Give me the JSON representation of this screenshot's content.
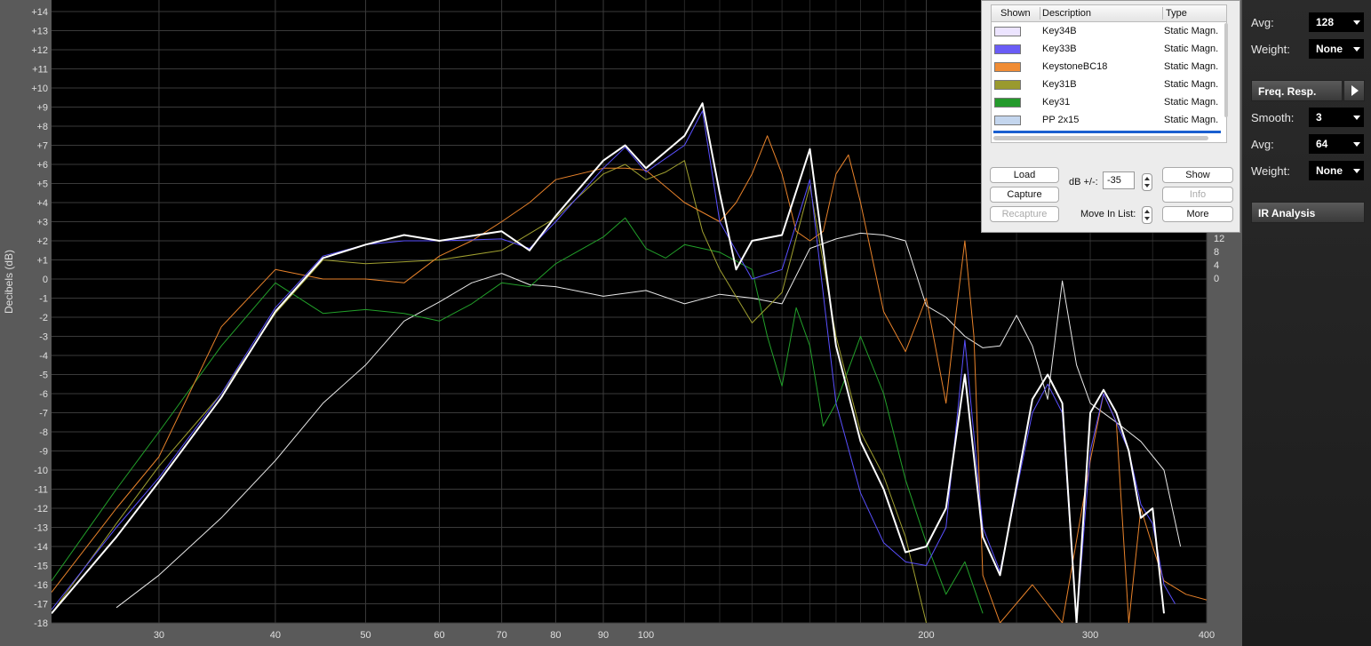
{
  "chart_data": {
    "type": "line",
    "ylabel": "Decibels (dB)",
    "xscale": "log",
    "xlim": [
      23,
      400
    ],
    "ylim": [
      -18,
      14
    ],
    "yticks": [
      "+14",
      "+13",
      "+12",
      "+11",
      "+10",
      "+9",
      "+8",
      "+7",
      "+6",
      "+5",
      "+4",
      "+3",
      "+2",
      "+1",
      "0",
      "-1",
      "-2",
      "-3",
      "-4",
      "-5",
      "-6",
      "-7",
      "-8",
      "-9",
      "-10",
      "-11",
      "-12",
      "-13",
      "-14",
      "-15",
      "-16",
      "-17",
      "-18"
    ],
    "xticks": [
      {
        "v": 30,
        "label": "30"
      },
      {
        "v": 40,
        "label": "40"
      },
      {
        "v": 50,
        "label": "50"
      },
      {
        "v": 60,
        "label": "60"
      },
      {
        "v": 70,
        "label": "70"
      },
      {
        "v": 80,
        "label": "80"
      },
      {
        "v": 90,
        "label": "90"
      },
      {
        "v": 100,
        "label": "100"
      },
      {
        "v": 200,
        "label": "200"
      },
      {
        "v": 300,
        "label": "300"
      },
      {
        "v": 400,
        "label": "400"
      }
    ],
    "right_ticks": [
      "12",
      "8",
      "4",
      "0"
    ],
    "grid": true,
    "series": [
      {
        "name": "PP 2x15",
        "color": "#e8e8e8",
        "width": 1,
        "points": [
          [
            27,
            -17.2
          ],
          [
            30,
            -15.5
          ],
          [
            35,
            -12.5
          ],
          [
            40,
            -9.5
          ],
          [
            45,
            -6.5
          ],
          [
            50,
            -4.5
          ],
          [
            55,
            -2.2
          ],
          [
            60,
            -1.2
          ],
          [
            65,
            -0.2
          ],
          [
            70,
            0.3
          ],
          [
            75,
            -0.3
          ],
          [
            80,
            -0.4
          ],
          [
            90,
            -0.9
          ],
          [
            100,
            -0.6
          ],
          [
            110,
            -1.3
          ],
          [
            120,
            -0.8
          ],
          [
            130,
            -1.0
          ],
          [
            140,
            -1.3
          ],
          [
            150,
            1.6
          ],
          [
            160,
            2.1
          ],
          [
            170,
            2.4
          ],
          [
            180,
            2.3
          ],
          [
            190,
            2.0
          ],
          [
            200,
            -1.4
          ],
          [
            210,
            -2.0
          ],
          [
            220,
            -3.0
          ],
          [
            230,
            -3.6
          ],
          [
            240,
            -3.5
          ],
          [
            250,
            -1.9
          ],
          [
            260,
            -3.5
          ],
          [
            270,
            -6.3
          ],
          [
            280,
            -0.1
          ],
          [
            290,
            -4.5
          ],
          [
            300,
            -6.5
          ],
          [
            320,
            -7.5
          ],
          [
            340,
            -8.5
          ],
          [
            360,
            -10.0
          ],
          [
            375,
            -14
          ]
        ]
      },
      {
        "name": "Key31",
        "color": "#22a02a",
        "width": 1,
        "points": [
          [
            23,
            -15.8
          ],
          [
            27,
            -11
          ],
          [
            30,
            -8
          ],
          [
            35,
            -3.5
          ],
          [
            40,
            -0.2
          ],
          [
            45,
            -1.8
          ],
          [
            50,
            -1.6
          ],
          [
            55,
            -1.8
          ],
          [
            60,
            -2.2
          ],
          [
            65,
            -1.3
          ],
          [
            70,
            -0.2
          ],
          [
            75,
            -0.4
          ],
          [
            80,
            0.8
          ],
          [
            90,
            2.2
          ],
          [
            95,
            3.2
          ],
          [
            100,
            1.6
          ],
          [
            105,
            1.1
          ],
          [
            110,
            1.8
          ],
          [
            120,
            1.4
          ],
          [
            130,
            0.5
          ],
          [
            135,
            -3.0
          ],
          [
            140,
            -5.6
          ],
          [
            145,
            -1.5
          ],
          [
            150,
            -3.5
          ],
          [
            155,
            -7.7
          ],
          [
            160,
            -6.5
          ],
          [
            170,
            -3.0
          ],
          [
            180,
            -6.0
          ],
          [
            190,
            -10.5
          ],
          [
            200,
            -13.8
          ],
          [
            210,
            -16.5
          ],
          [
            220,
            -14.8
          ],
          [
            230,
            -17.5
          ]
        ]
      },
      {
        "name": "Key31B",
        "color": "#a0a030",
        "width": 1,
        "points": [
          [
            23,
            -17.5
          ],
          [
            27,
            -12.8
          ],
          [
            30,
            -9.8
          ],
          [
            35,
            -6.0
          ],
          [
            40,
            -1.8
          ],
          [
            45,
            1.0
          ],
          [
            50,
            0.8
          ],
          [
            55,
            0.9
          ],
          [
            60,
            1.0
          ],
          [
            70,
            1.5
          ],
          [
            80,
            3.2
          ],
          [
            90,
            5.5
          ],
          [
            95,
            6.0
          ],
          [
            100,
            5.2
          ],
          [
            105,
            5.6
          ],
          [
            110,
            6.2
          ],
          [
            115,
            2.5
          ],
          [
            120,
            0.5
          ],
          [
            130,
            -2.3
          ],
          [
            140,
            -0.7
          ],
          [
            150,
            4.9
          ],
          [
            160,
            -3.0
          ],
          [
            170,
            -8.0
          ],
          [
            180,
            -10.3
          ],
          [
            190,
            -13.5
          ],
          [
            200,
            -18
          ]
        ]
      },
      {
        "name": "KeystoneBC18",
        "color": "#e8822a",
        "width": 1,
        "points": [
          [
            23,
            -16.4
          ],
          [
            27,
            -12.0
          ],
          [
            30,
            -9.3
          ],
          [
            35,
            -2.5
          ],
          [
            40,
            0.5
          ],
          [
            45,
            0.0
          ],
          [
            50,
            0.0
          ],
          [
            55,
            -0.2
          ],
          [
            60,
            1.2
          ],
          [
            65,
            2.0
          ],
          [
            70,
            3.0
          ],
          [
            75,
            4.0
          ],
          [
            80,
            5.2
          ],
          [
            90,
            5.8
          ],
          [
            95,
            5.8
          ],
          [
            100,
            5.7
          ],
          [
            110,
            4.0
          ],
          [
            120,
            3.0
          ],
          [
            125,
            4.0
          ],
          [
            130,
            5.5
          ],
          [
            135,
            7.5
          ],
          [
            140,
            5.5
          ],
          [
            145,
            2.5
          ],
          [
            150,
            2.0
          ],
          [
            155,
            2.5
          ],
          [
            160,
            5.5
          ],
          [
            165,
            6.5
          ],
          [
            170,
            4.0
          ],
          [
            180,
            -1.7
          ],
          [
            190,
            -3.8
          ],
          [
            200,
            -1.0
          ],
          [
            210,
            -6.5
          ],
          [
            215,
            -2.0
          ],
          [
            220,
            2.0
          ],
          [
            225,
            -3.0
          ],
          [
            230,
            -15.5
          ],
          [
            240,
            -18
          ],
          [
            260,
            -16
          ],
          [
            280,
            -18
          ],
          [
            300,
            -9.5
          ],
          [
            310,
            -6.0
          ],
          [
            320,
            -7.5
          ],
          [
            330,
            -18
          ],
          [
            340,
            -12.0
          ],
          [
            350,
            -14.0
          ],
          [
            360,
            -15.8
          ],
          [
            380,
            -16.5
          ],
          [
            400,
            -16.8
          ]
        ]
      },
      {
        "name": "Key33B",
        "color": "#5a50ff",
        "width": 1,
        "points": [
          [
            23,
            -17.3
          ],
          [
            27,
            -13
          ],
          [
            30,
            -10.4
          ],
          [
            35,
            -6.0
          ],
          [
            40,
            -1.5
          ],
          [
            45,
            1.2
          ],
          [
            50,
            1.8
          ],
          [
            55,
            2.0
          ],
          [
            60,
            2.0
          ],
          [
            70,
            2.1
          ],
          [
            75,
            1.6
          ],
          [
            80,
            3.0
          ],
          [
            90,
            5.8
          ],
          [
            95,
            6.9
          ],
          [
            100,
            5.6
          ],
          [
            110,
            7.0
          ],
          [
            115,
            8.8
          ],
          [
            120,
            3.0
          ],
          [
            130,
            0.0
          ],
          [
            140,
            0.5
          ],
          [
            150,
            5.2
          ],
          [
            160,
            -6.5
          ],
          [
            170,
            -11.2
          ],
          [
            180,
            -13.8
          ],
          [
            190,
            -14.8
          ],
          [
            200,
            -15.0
          ],
          [
            210,
            -13.0
          ],
          [
            220,
            -3.2
          ],
          [
            230,
            -13.0
          ],
          [
            240,
            -15.3
          ],
          [
            260,
            -7.0
          ],
          [
            270,
            -5.5
          ],
          [
            280,
            -7.0
          ],
          [
            290,
            -18
          ],
          [
            300,
            -9.0
          ],
          [
            310,
            -6.0
          ],
          [
            320,
            -7.5
          ],
          [
            330,
            -9.0
          ],
          [
            340,
            -11.8
          ],
          [
            350,
            -12.8
          ],
          [
            360,
            -16.0
          ],
          [
            370,
            -17
          ]
        ]
      },
      {
        "name": "Key34B",
        "color": "#ffffff",
        "width": 2,
        "points": [
          [
            23,
            -17.5
          ],
          [
            27,
            -13.5
          ],
          [
            30,
            -10.6
          ],
          [
            35,
            -6.2
          ],
          [
            40,
            -1.7
          ],
          [
            45,
            1.1
          ],
          [
            50,
            1.8
          ],
          [
            55,
            2.3
          ],
          [
            60,
            2.0
          ],
          [
            70,
            2.5
          ],
          [
            75,
            1.5
          ],
          [
            80,
            3.3
          ],
          [
            90,
            6.2
          ],
          [
            95,
            7.0
          ],
          [
            100,
            5.8
          ],
          [
            110,
            7.5
          ],
          [
            115,
            9.2
          ],
          [
            120,
            4.5
          ],
          [
            125,
            0.5
          ],
          [
            130,
            2.0
          ],
          [
            140,
            2.3
          ],
          [
            150,
            6.8
          ],
          [
            160,
            -3.5
          ],
          [
            170,
            -8.5
          ],
          [
            180,
            -11.0
          ],
          [
            190,
            -14.3
          ],
          [
            200,
            -14.0
          ],
          [
            210,
            -12.0
          ],
          [
            220,
            -5.0
          ],
          [
            230,
            -13.5
          ],
          [
            240,
            -15.5
          ],
          [
            260,
            -6.3
          ],
          [
            270,
            -5.0
          ],
          [
            280,
            -6.5
          ],
          [
            290,
            -18
          ],
          [
            300,
            -7.0
          ],
          [
            310,
            -5.8
          ],
          [
            320,
            -7.0
          ],
          [
            330,
            -9.0
          ],
          [
            340,
            -12.5
          ],
          [
            350,
            -12.0
          ],
          [
            360,
            -17.5
          ]
        ]
      }
    ]
  },
  "panel": {
    "col_shown": "Shown",
    "col_description": "Description",
    "col_type": "Type",
    "rows": [
      {
        "desc": "Key34B",
        "type": "Static Magn.",
        "color": "#ece4ff"
      },
      {
        "desc": "Key33B",
        "type": "Static Magn.",
        "color": "#6a5cf6"
      },
      {
        "desc": "KeystoneBC18",
        "type": "Static Magn.",
        "color": "#f08c34"
      },
      {
        "desc": "Key31B",
        "type": "Static Magn.",
        "color": "#9a9a2e"
      },
      {
        "desc": "Key31",
        "type": "Static Magn.",
        "color": "#249a2c"
      },
      {
        "desc": "PP 2x15",
        "type": "Static Magn.",
        "color": "#c4d6ee"
      }
    ],
    "load": "Load",
    "capture": "Capture",
    "recapture": "Recapture",
    "db_label": "dB +/-:",
    "db_value": "-35",
    "move_label": "Move In List:",
    "show": "Show",
    "info": "Info",
    "more": "More"
  },
  "side": {
    "avg1_label": "Avg:",
    "avg1_value": "128",
    "weight1_label": "Weight:",
    "weight1_value": "None",
    "freq_button": "Freq. Resp.",
    "smooth_label": "Smooth:",
    "smooth_value": "3",
    "avg2_label": "Avg:",
    "avg2_value": "64",
    "weight2_label": "Weight:",
    "weight2_value": "None",
    "ir_button": "IR Analysis"
  }
}
